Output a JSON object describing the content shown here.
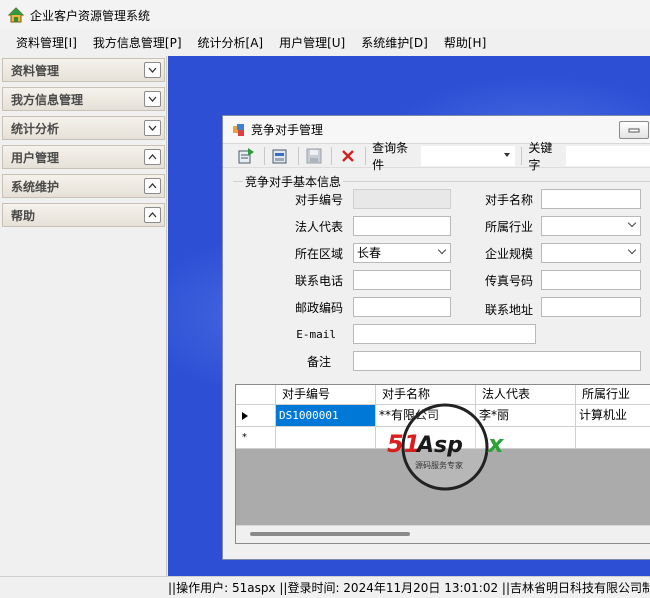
{
  "app": {
    "title": "企业客户资源管理系统",
    "icon": "house-icon"
  },
  "menu": [
    "资料管理[I]",
    "我方信息管理[P]",
    "统计分析[A]",
    "用户管理[U]",
    "系统维护[D]",
    "帮助[H]"
  ],
  "sidebar": [
    {
      "label": "资料管理",
      "icon": "chevron-down-icon"
    },
    {
      "label": "我方信息管理",
      "icon": "chevron-down-icon"
    },
    {
      "label": "统计分析",
      "icon": "chevron-down-icon"
    },
    {
      "label": "用户管理",
      "icon": "chevron-up-icon"
    },
    {
      "label": "系统维护",
      "icon": "chevron-up-icon"
    },
    {
      "label": "帮助",
      "icon": "chevron-up-icon"
    }
  ],
  "child_window": {
    "title": "竞争对手管理",
    "toolbar": {
      "query_label": "查询条件",
      "query_value": "",
      "keyword_label": "关键字",
      "keyword_value": ""
    },
    "group_title": "竞争对手基本信息",
    "fields": {
      "id": {
        "label": "对手编号",
        "value": ""
      },
      "name": {
        "label": "对手名称",
        "value": ""
      },
      "legal": {
        "label": "法人代表",
        "value": ""
      },
      "industry": {
        "label": "所属行业",
        "value": ""
      },
      "region": {
        "label": "所在区域",
        "value": "长春"
      },
      "scale": {
        "label": "企业规模",
        "value": ""
      },
      "phone": {
        "label": "联系电话",
        "value": ""
      },
      "fax": {
        "label": "传真号码",
        "value": ""
      },
      "zip": {
        "label": "邮政编码",
        "value": ""
      },
      "address": {
        "label": "联系地址",
        "value": ""
      },
      "email": {
        "label": "E-mail",
        "value": ""
      },
      "remark": {
        "label": "备注",
        "value": ""
      }
    },
    "grid": {
      "columns": [
        "对手编号",
        "对手名称",
        "法人代表",
        "所属行业"
      ],
      "rows": [
        [
          "DS1000001",
          "**有限公司",
          "李*丽",
          "计算机业"
        ]
      ],
      "new_row_marker": "*"
    }
  },
  "watermark": {
    "brand": "51Aspx",
    "tagline": "源码服务专家"
  },
  "status": "||操作用户: 51aspx  ||登录时间: 2024年11月20日 13:01:02  ||吉林省明日科技有限公司制",
  "colors": {
    "desktop": "#2d4fd4",
    "selection": "#0078d7"
  }
}
